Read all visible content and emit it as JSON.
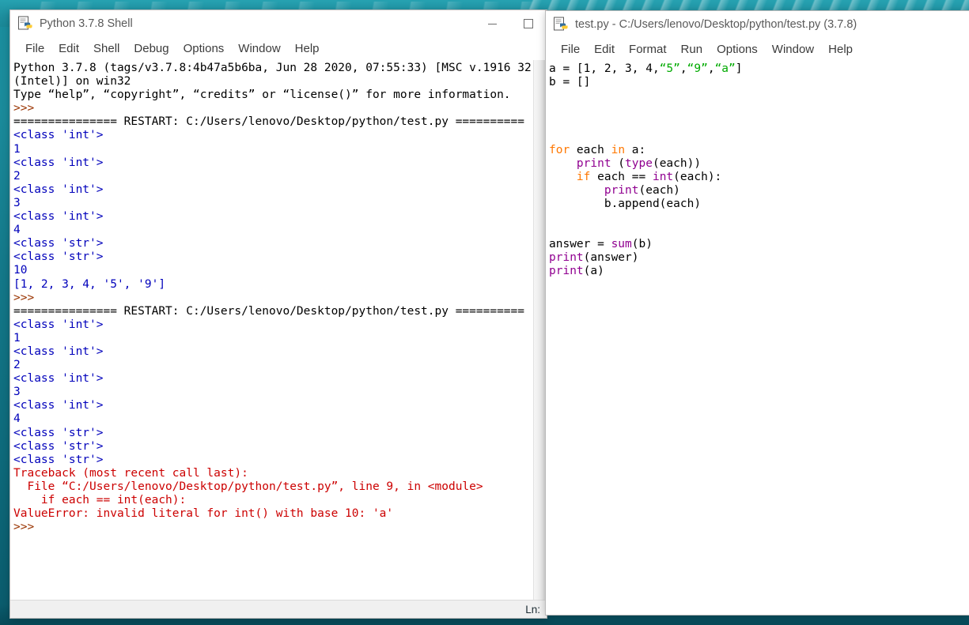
{
  "desktop": {
    "wallpaper_description": "teal-water-wallpaper"
  },
  "shell_window": {
    "title": "Python 3.7.8 Shell",
    "icon": "python-idle-icon",
    "menus": [
      "File",
      "Edit",
      "Shell",
      "Debug",
      "Options",
      "Window",
      "Help"
    ],
    "window_buttons": {
      "minimize": "—",
      "maximize": "□"
    },
    "statusbar": "Ln:",
    "lines": [
      [
        {
          "t": "Python 3.7.8 (tags/v3.7.8:4b47a5b6ba, Jun 28 2020, 07:55:33) [MSC v.1916 32",
          "c": "c-plain"
        }
      ],
      [
        {
          "t": "(Intel)] on win32",
          "c": "c-plain"
        }
      ],
      [
        {
          "t": "Type “help”, “copyright”, “credits” or “license()” for more information.",
          "c": "c-plain"
        }
      ],
      [
        {
          "t": ">>>",
          "c": "c-prompt"
        }
      ],
      [
        {
          "t": "=============== RESTART: C:/Users/lenovo/Desktop/python/test.py ==========",
          "c": "c-plain"
        }
      ],
      [
        {
          "t": "<class 'int'>",
          "c": "c-out"
        }
      ],
      [
        {
          "t": "1",
          "c": "c-out"
        }
      ],
      [
        {
          "t": "<class 'int'>",
          "c": "c-out"
        }
      ],
      [
        {
          "t": "2",
          "c": "c-out"
        }
      ],
      [
        {
          "t": "<class 'int'>",
          "c": "c-out"
        }
      ],
      [
        {
          "t": "3",
          "c": "c-out"
        }
      ],
      [
        {
          "t": "<class 'int'>",
          "c": "c-out"
        }
      ],
      [
        {
          "t": "4",
          "c": "c-out"
        }
      ],
      [
        {
          "t": "<class 'str'>",
          "c": "c-out"
        }
      ],
      [
        {
          "t": "<class 'str'>",
          "c": "c-out"
        }
      ],
      [
        {
          "t": "10",
          "c": "c-out"
        }
      ],
      [
        {
          "t": "[1, 2, 3, 4, '5', '9']",
          "c": "c-out"
        }
      ],
      [
        {
          "t": ">>>",
          "c": "c-prompt"
        }
      ],
      [
        {
          "t": "=============== RESTART: C:/Users/lenovo/Desktop/python/test.py ==========",
          "c": "c-plain"
        }
      ],
      [
        {
          "t": "<class 'int'>",
          "c": "c-out"
        }
      ],
      [
        {
          "t": "1",
          "c": "c-out"
        }
      ],
      [
        {
          "t": "<class 'int'>",
          "c": "c-out"
        }
      ],
      [
        {
          "t": "2",
          "c": "c-out"
        }
      ],
      [
        {
          "t": "<class 'int'>",
          "c": "c-out"
        }
      ],
      [
        {
          "t": "3",
          "c": "c-out"
        }
      ],
      [
        {
          "t": "<class 'int'>",
          "c": "c-out"
        }
      ],
      [
        {
          "t": "4",
          "c": "c-out"
        }
      ],
      [
        {
          "t": "<class 'str'>",
          "c": "c-out"
        }
      ],
      [
        {
          "t": "<class 'str'>",
          "c": "c-out"
        }
      ],
      [
        {
          "t": "<class 'str'>",
          "c": "c-out"
        }
      ],
      [
        {
          "t": "Traceback (most recent call last):",
          "c": "c-err"
        }
      ],
      [
        {
          "t": "  File “C:/Users/lenovo/Desktop/python/test.py”, line 9, in <module>",
          "c": "c-err"
        }
      ],
      [
        {
          "t": "    if each == int(each):",
          "c": "c-err"
        }
      ],
      [
        {
          "t": "ValueError: invalid literal for int() with base 10: 'a'",
          "c": "c-err"
        }
      ],
      [
        {
          "t": ">>>",
          "c": "c-prompt"
        }
      ]
    ]
  },
  "editor_window": {
    "title": "test.py - C:/Users/lenovo/Desktop/python/test.py (3.7.8)",
    "icon": "python-idle-icon",
    "menus": [
      "File",
      "Edit",
      "Format",
      "Run",
      "Options",
      "Window",
      "Help"
    ],
    "lines": [
      [
        {
          "t": "a = [1, 2, 3, 4,",
          "c": "c-plain"
        },
        {
          "t": "“5”",
          "c": "c-str"
        },
        {
          "t": ",",
          "c": "c-plain"
        },
        {
          "t": "“9”",
          "c": "c-str"
        },
        {
          "t": ",",
          "c": "c-plain"
        },
        {
          "t": "“a”",
          "c": "c-str"
        },
        {
          "t": "]",
          "c": "c-plain"
        }
      ],
      [
        {
          "t": "b = []",
          "c": "c-plain"
        }
      ],
      [
        {
          "t": "",
          "c": "c-plain"
        }
      ],
      [
        {
          "t": "",
          "c": "c-plain"
        }
      ],
      [
        {
          "t": "",
          "c": "c-plain"
        }
      ],
      [
        {
          "t": "",
          "c": "c-plain"
        }
      ],
      [
        {
          "t": "for",
          "c": "c-kw"
        },
        {
          "t": " each ",
          "c": "c-plain"
        },
        {
          "t": "in",
          "c": "c-kw"
        },
        {
          "t": " a:",
          "c": "c-plain"
        }
      ],
      [
        {
          "t": "    ",
          "c": "c-plain"
        },
        {
          "t": "print",
          "c": "c-builtin"
        },
        {
          "t": " (",
          "c": "c-plain"
        },
        {
          "t": "type",
          "c": "c-builtin"
        },
        {
          "t": "(each))",
          "c": "c-plain"
        }
      ],
      [
        {
          "t": "    ",
          "c": "c-plain"
        },
        {
          "t": "if",
          "c": "c-kw"
        },
        {
          "t": " each == ",
          "c": "c-plain"
        },
        {
          "t": "int",
          "c": "c-builtin"
        },
        {
          "t": "(each):",
          "c": "c-plain"
        }
      ],
      [
        {
          "t": "        ",
          "c": "c-plain"
        },
        {
          "t": "print",
          "c": "c-builtin"
        },
        {
          "t": "(each)",
          "c": "c-plain"
        }
      ],
      [
        {
          "t": "        b.append(each)",
          "c": "c-plain"
        }
      ],
      [
        {
          "t": "",
          "c": "c-plain"
        }
      ],
      [
        {
          "t": "",
          "c": "c-plain"
        }
      ],
      [
        {
          "t": "answer = ",
          "c": "c-plain"
        },
        {
          "t": "sum",
          "c": "c-builtin"
        },
        {
          "t": "(b)",
          "c": "c-plain"
        }
      ],
      [
        {
          "t": "print",
          "c": "c-builtin"
        },
        {
          "t": "(answer)",
          "c": "c-plain"
        }
      ],
      [
        {
          "t": "print",
          "c": "c-builtin"
        },
        {
          "t": "(a)",
          "c": "c-plain"
        }
      ]
    ]
  }
}
